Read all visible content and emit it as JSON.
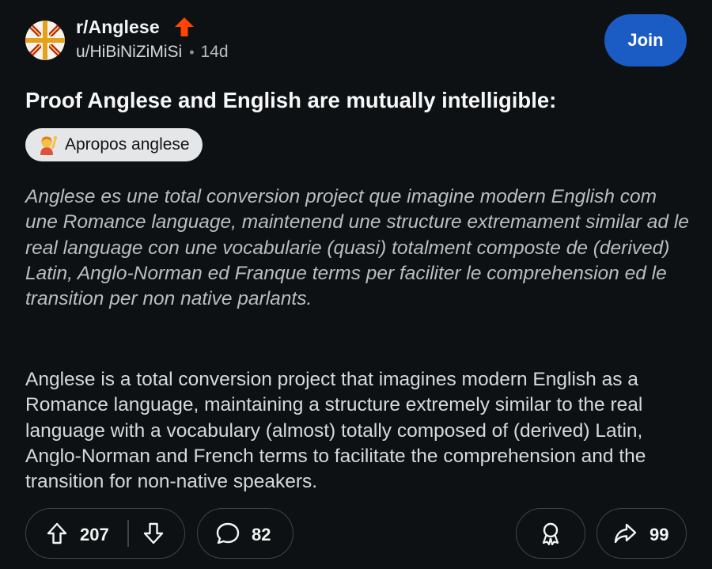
{
  "post": {
    "subreddit": "r/Anglese",
    "author": "u/HiBiNiZiMiSi",
    "separator": "•",
    "age": "14d",
    "join_label": "Join",
    "title": "Proof Anglese and English are mutually intelligible:",
    "flair": {
      "icon": "person-raising-hand-emoji",
      "label": "Apropos anglese"
    },
    "body": {
      "anglese_text": "Anglese es une total conversion project que imagine modern English com une Romance language, maintenend une structure extremament similar ad le real language con une vocabularie (quasi) totalment composte de (derived) Latin, Anglo-Norman ed Franque terms per faciliter le comprehension ed le transition per non native parlants.",
      "english_text": "Anglese is a total conversion project that imagines modern English as a Romance language, maintaining a structure extremely similar to the real language with a vocabulary (almost) totally composed of (derived) Latin, Anglo-Norman and French terms to facilitate the comprehension and the transition for non-native speakers."
    }
  },
  "actions": {
    "upvotes": "207",
    "comments": "82",
    "shares": "99"
  },
  "icons": {
    "subreddit_avatar": "union-jack-avatar-icon",
    "trending": "orange-up-arrow-icon",
    "upvote": "upvote-arrow-icon",
    "downvote": "downvote-arrow-icon",
    "comment": "speech-bubble-icon",
    "award": "award-ribbon-icon",
    "share": "share-arrow-icon"
  },
  "colors": {
    "background": "#0e1113",
    "join_button": "#1a5bc4",
    "trending_arrow": "#ff4500",
    "flair_background": "#e4e6e8",
    "pill_border": "#3e4447"
  }
}
